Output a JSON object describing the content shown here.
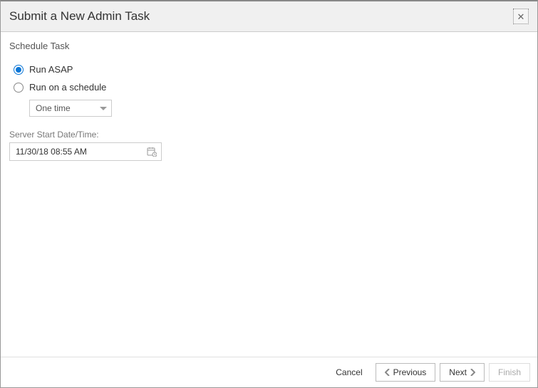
{
  "dialog": {
    "title": "Submit a New Admin Task",
    "section_label": "Schedule Task",
    "radio_asap": "Run ASAP",
    "radio_schedule": "Run on a schedule",
    "schedule_mode": "One time",
    "start_label": "Server Start Date/Time:",
    "start_value": "11/30/18 08:55 AM"
  },
  "footer": {
    "cancel": "Cancel",
    "previous": "Previous",
    "next": "Next",
    "finish": "Finish"
  }
}
